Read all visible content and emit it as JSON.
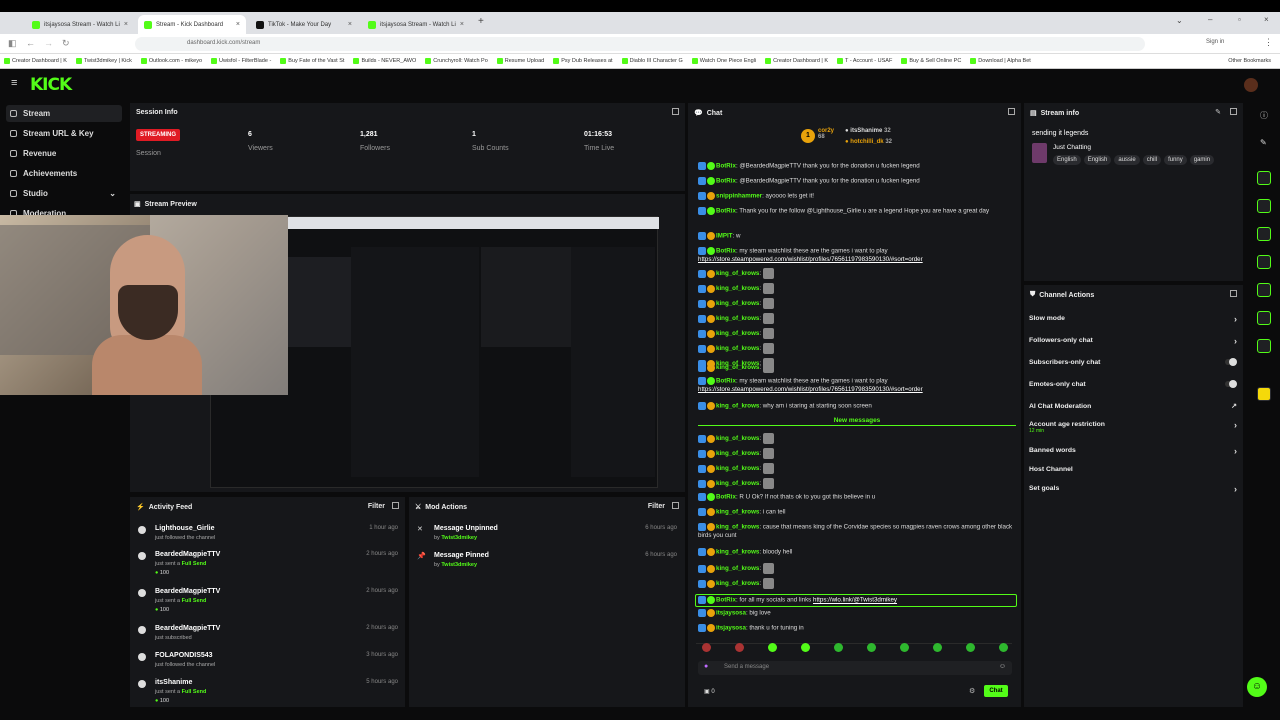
{
  "browser": {
    "tabs": [
      {
        "title": "itsjaysosa Stream - Watch Li"
      },
      {
        "title": "Stream - Kick Dashboard"
      },
      {
        "title": "TikTok - Make Your Day"
      },
      {
        "title": "itsjaysosa Stream - Watch Li"
      }
    ],
    "url": "dashboard.kick.com/stream",
    "bookmarks": [
      "Creator Dashboard | K",
      "Twist3dmikey | Kick",
      "Outlook.com - mikeyo",
      "Uwisfol - FilterBlade -",
      "Buy Fate of the Vast St",
      "Builds - NEVER_AWO",
      "Crunchyroll: Watch Po",
      "Resume Upload",
      "Psy Dub Releases at",
      "Diablo III Character G",
      "Watch One Piece Engli",
      "Creator Dashboard | K",
      "T - Account - USAF",
      "Buy & Sell Online PC",
      "Download | Alpha Bet"
    ],
    "other_bookmarks": "Other Bookmarks",
    "profile": "Sign in"
  },
  "kick": {
    "logo": "KICK"
  },
  "sidebar": {
    "items": [
      "Stream",
      "Stream URL & Key",
      "Revenue",
      "Achievements",
      "Studio",
      "Moderation"
    ]
  },
  "session": {
    "title": "Session Info",
    "status": "STREAMING",
    "stats": [
      {
        "value": "6",
        "label": "Viewers"
      },
      {
        "value": "1,281",
        "label": "Followers"
      },
      {
        "value": "1",
        "label": "Sub Counts"
      },
      {
        "value": "01:16:53",
        "label": "Time Live"
      }
    ],
    "session_label": "Session"
  },
  "preview": {
    "title": "Stream Preview"
  },
  "activity": {
    "title": "Activity Feed",
    "filter": "Filter",
    "items": [
      {
        "name": "Lighthouse_Girlie",
        "sub": "just followed the channel",
        "time": "1 hour ago"
      },
      {
        "name": "BeardedMagpieTTV",
        "sub": "just sent a",
        "gift": "Full Send",
        "amount": "100",
        "time": "2 hours ago"
      },
      {
        "name": "BeardedMagpieTTV",
        "sub": "just sent a",
        "gift": "Full Send",
        "amount": "100",
        "time": "2 hours ago"
      },
      {
        "name": "BeardedMagpieTTV",
        "sub": "just subscribed",
        "time": "2 hours ago"
      },
      {
        "name": "FOLAPONDIS543",
        "sub": "just followed the channel",
        "time": "3 hours ago"
      },
      {
        "name": "itsShanime",
        "sub": "just sent a",
        "gift": "Full Send",
        "amount": "100",
        "time": "5 hours ago"
      }
    ]
  },
  "mod": {
    "title": "Mod Actions",
    "filter": "Filter",
    "items": [
      {
        "action": "Message Unpinned",
        "by": "by",
        "user": "Twist3dmikey",
        "time": "6 hours ago"
      },
      {
        "action": "Message Pinned",
        "by": "by",
        "user": "Twist3dmikey",
        "time": "6 hours ago"
      }
    ]
  },
  "chat": {
    "title": "Chat",
    "leaders": [
      {
        "name": "cor2y",
        "count": "68"
      },
      {
        "name": "itsShanime",
        "count": "32"
      },
      {
        "name": "hotchilli_dk",
        "count": "32"
      }
    ],
    "messages": [
      {
        "user": "BotRix",
        "text": "@BeardedMagpieTTV thank you for the donation u fucken legend"
      },
      {
        "user": "BotRix",
        "text": "@BeardedMagpieTTV thank you for the donation u fucken legend"
      },
      {
        "user": "snippinhammer",
        "text": "ayoooo lets get it!"
      },
      {
        "user": "BotRix",
        "text": "Thank you for the follow @Lighthouse_Girlie u are a legend Hope you are have a great day"
      },
      {
        "user": "IMPIT",
        "text": "w"
      },
      {
        "user": "BotRix",
        "text": "my steam watchlist these are the games i want to play",
        "link": "https://store.steampowered.com/wishlist/profiles/76561197983590130/#sort=order"
      },
      {
        "user": "king_of_krows",
        "text": ""
      },
      {
        "user": "king_of_krows",
        "text": ""
      },
      {
        "user": "king_of_krows",
        "text": ""
      },
      {
        "user": "king_of_krows",
        "text": ""
      },
      {
        "user": "king_of_krows",
        "text": ""
      },
      {
        "user": "king_of_krows",
        "text": ""
      },
      {
        "user": "king_of_krows",
        "text": ""
      },
      {
        "user": "king_of_krows",
        "text": ""
      },
      {
        "user": "BotRix",
        "text": "my steam watchlist these are the games i want to play",
        "link": "https://store.steampowered.com/wishlist/profiles/76561197983590130/#sort=order"
      },
      {
        "user": "king_of_krows",
        "text": "why am i staring at starting soon screen"
      }
    ],
    "new_messages": "New messages",
    "messages2": [
      {
        "user": "king_of_krows",
        "text": ""
      },
      {
        "user": "king_of_krows",
        "text": ""
      },
      {
        "user": "king_of_krows",
        "text": ""
      },
      {
        "user": "king_of_krows",
        "text": ""
      },
      {
        "user": "BotRix",
        "text": "R U Ok? If not thats ok to you got this believe in u"
      },
      {
        "user": "king_of_krows",
        "text": "i can tell"
      },
      {
        "user": "king_of_krows",
        "text": "cause that means king of the Corvidae species so magpies raven crows among other black birds you cunt"
      },
      {
        "user": "king_of_krows",
        "text": "bloody hell"
      },
      {
        "user": "king_of_krows",
        "text": ""
      },
      {
        "user": "king_of_krows",
        "text": ""
      },
      {
        "user": "BotRix",
        "text": "for all my socials and links",
        "link": "https://wlo.link/@Twist3dmikey"
      },
      {
        "user": "itsjaysosa",
        "text": "big love"
      },
      {
        "user": "itsjaysosa",
        "text": "thank u for tuning in"
      }
    ],
    "input_placeholder": "Send a message",
    "count": "0",
    "send": "Chat"
  },
  "stream_info": {
    "title": "Stream info",
    "stream_title": "sending it legends",
    "category": "Just Chatting",
    "tags": [
      "English",
      "English",
      "aussie",
      "chill",
      "funny",
      "gamin"
    ]
  },
  "channel_actions": {
    "title": "Channel Actions",
    "items": [
      {
        "label": "Slow mode",
        "kind": "chev"
      },
      {
        "label": "Followers-only chat",
        "kind": "chev"
      },
      {
        "label": "Subscribers-only chat",
        "kind": "toggle"
      },
      {
        "label": "Emotes-only chat",
        "kind": "toggle"
      },
      {
        "label": "AI Chat Moderation",
        "kind": "link"
      },
      {
        "label": "Account age restriction",
        "sub": "12 min",
        "kind": "chev"
      },
      {
        "label": "Banned words",
        "kind": "chev"
      },
      {
        "label": "Host Channel",
        "kind": "none"
      },
      {
        "label": "Set goals",
        "kind": "chev"
      }
    ]
  },
  "colors": {
    "accent": "#53fc18",
    "panel": "#16171a",
    "bg": "#0b0b0c",
    "live": "#e01b24"
  }
}
